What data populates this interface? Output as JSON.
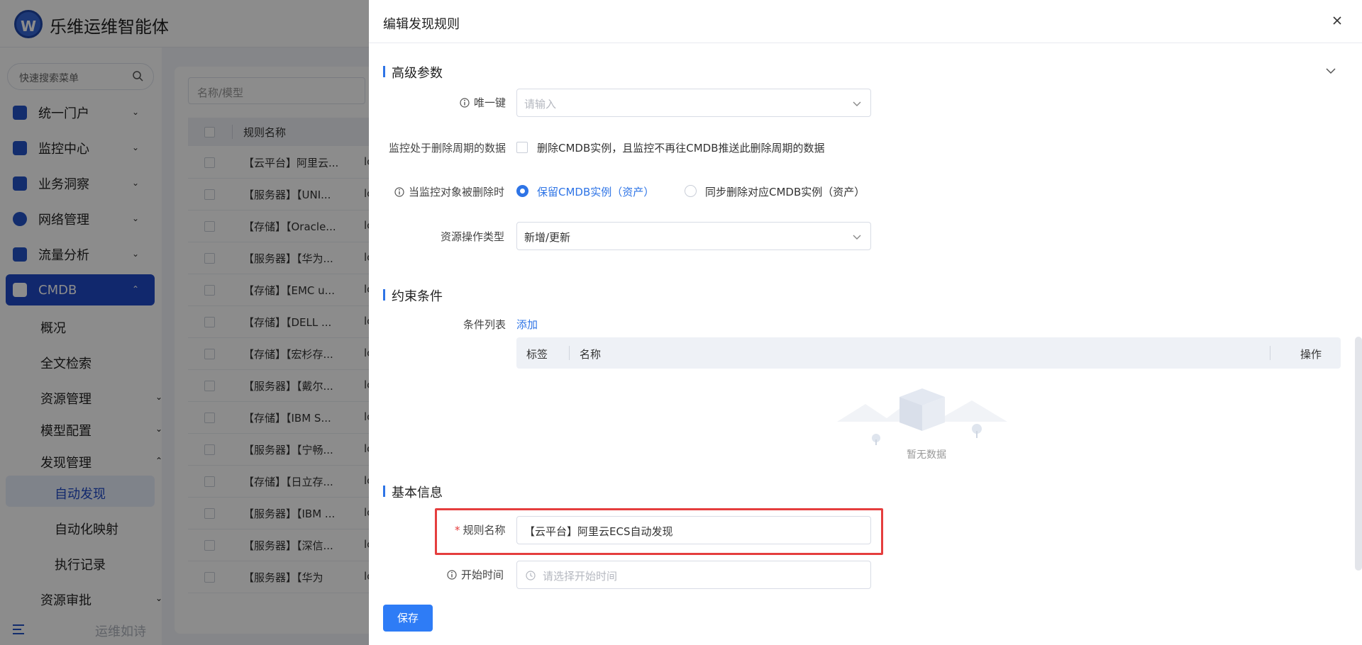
{
  "app": {
    "title": "乐维运维智能体",
    "logo_text": "W"
  },
  "sidebar": {
    "search_placeholder": "快速搜索菜单",
    "menu": [
      {
        "label": "统一门户",
        "icon": "portal-icon"
      },
      {
        "label": "监控中心",
        "icon": "monitor-icon"
      },
      {
        "label": "业务洞察",
        "icon": "insight-icon"
      },
      {
        "label": "网络管理",
        "icon": "globe-icon"
      },
      {
        "label": "流量分析",
        "icon": "chart-icon"
      },
      {
        "label": "CMDB",
        "icon": "cube-icon",
        "active": true
      }
    ],
    "submenu": [
      "概况",
      "全文检索",
      "资源管理",
      "模型配置",
      "发现管理",
      "自动发现",
      "自动化映射",
      "执行记录",
      "资源审批"
    ],
    "footer_text": "运维如诗"
  },
  "background": {
    "search_placeholder": "名称/模型",
    "column_header": "规则名称",
    "rows": [
      "【云平台】阿里云...",
      "【服务器】【UNI...",
      "【存储】【Oracle...",
      "【服务器】【华为...",
      "【存储】【EMC u...",
      "【存储】【DELL ...",
      "【存储】【宏杉存...",
      "【服务器】【戴尔...",
      "【存储】【IBM S...",
      "【服务器】【宁畅...",
      "【存储】【日立存...",
      "【服务器】【IBM ...",
      "【服务器】【深信...",
      "【服务器】【华为"
    ],
    "row_tail": "lc"
  },
  "drawer": {
    "title": "编辑发现规则",
    "advanced": {
      "title": "高级参数",
      "unique_key_label": "唯一键",
      "unique_key_placeholder": "请输入",
      "delete_period_label": "监控处于删除周期的数据",
      "delete_period_checkbox": "删除CMDB实例，且监控不再往CMDB推送此删除周期的数据",
      "on_delete_label": "当监控对象被删除时",
      "radio_keep": "保留CMDB实例（资产）",
      "radio_sync_delete": "同步删除对应CMDB实例（资产）",
      "op_type_label": "资源操作类型",
      "op_type_value": "新增/更新"
    },
    "constraints": {
      "title": "约束条件",
      "list_label": "条件列表",
      "add_link": "添加",
      "columns": [
        "标签",
        "名称",
        "操作"
      ],
      "empty_text": "暂无数据"
    },
    "basic": {
      "title": "基本信息",
      "rule_name_label": "规则名称",
      "rule_name_value": "【云平台】阿里云ECS自动发现",
      "start_time_label": "开始时间",
      "start_time_placeholder": "请选择开始时间"
    },
    "save_label": "保存"
  },
  "colors": {
    "primary": "#2e74e6",
    "sidebar_active": "#1f49c6",
    "highlight": "#e53e3e"
  }
}
